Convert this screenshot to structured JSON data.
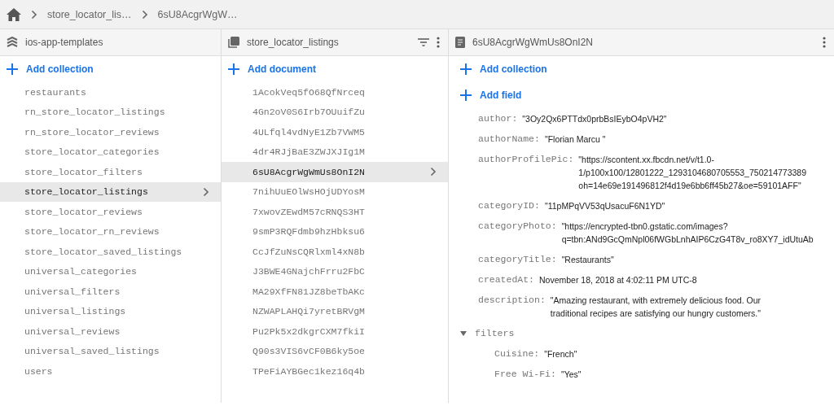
{
  "breadcrumb": [
    "store_locator_lis…",
    "6sU8AcgrWgW…"
  ],
  "collections": {
    "title": "ios-app-templates",
    "add_label": "Add collection",
    "items": [
      {
        "name": "restaurants",
        "selected": false
      },
      {
        "name": "rn_store_locator_listings",
        "selected": false
      },
      {
        "name": "rn_store_locator_reviews",
        "selected": false
      },
      {
        "name": "store_locator_categories",
        "selected": false
      },
      {
        "name": "store_locator_filters",
        "selected": false
      },
      {
        "name": "store_locator_listings",
        "selected": true
      },
      {
        "name": "store_locator_reviews",
        "selected": false
      },
      {
        "name": "store_locator_rn_reviews",
        "selected": false
      },
      {
        "name": "store_locator_saved_listings",
        "selected": false
      },
      {
        "name": "universal_categories",
        "selected": false
      },
      {
        "name": "universal_filters",
        "selected": false
      },
      {
        "name": "universal_listings",
        "selected": false
      },
      {
        "name": "universal_reviews",
        "selected": false
      },
      {
        "name": "universal_saved_listings",
        "selected": false
      },
      {
        "name": "users",
        "selected": false
      }
    ]
  },
  "documents": {
    "title": "store_locator_listings",
    "add_label": "Add document",
    "items": [
      {
        "name": "1AcokVeq5fO68QfNrceq",
        "selected": false
      },
      {
        "name": "4Gn2oV0S6Irb7OUuifZu",
        "selected": false
      },
      {
        "name": "4ULfql4vdNyE1Zb7VWM5",
        "selected": false
      },
      {
        "name": "4dr4RJjBaE3ZWJXJIg1M",
        "selected": false
      },
      {
        "name": "6sU8AcgrWgWmUs8OnI2N",
        "selected": true
      },
      {
        "name": "7nihUuEOlWsHOjUDYosM",
        "selected": false
      },
      {
        "name": "7xwovZEwdM57cRNQS3HT",
        "selected": false
      },
      {
        "name": "9smP3RQFdmb9hzHbksu6",
        "selected": false
      },
      {
        "name": "CcJfZuNsCQRlxml4xN8b",
        "selected": false
      },
      {
        "name": "J3BWE4GNajchFrru2FbC",
        "selected": false
      },
      {
        "name": "MA29XfFN81JZ8beTbAKc",
        "selected": false
      },
      {
        "name": "NZWAPLAHQi7yretBRVgM",
        "selected": false
      },
      {
        "name": "Pu2Pk5x2dkgrCXM7fkiI",
        "selected": false
      },
      {
        "name": "Q90s3VIS6vCF0B6ky5oe",
        "selected": false
      },
      {
        "name": "TPeFiAYBGec1kez16q4b",
        "selected": false
      }
    ]
  },
  "document": {
    "title": "6sU8AcgrWgWmUs8OnI2N",
    "add_collection": "Add collection",
    "add_field": "Add field",
    "fields": [
      {
        "kind": "field",
        "key": "author:",
        "value_lines": [
          "\"3Oy2Qx6PTTdx0prbBsIEybO4pVH2\""
        ]
      },
      {
        "kind": "field",
        "key": "authorName:",
        "value_lines": [
          "\"Florian Marcu \""
        ]
      },
      {
        "kind": "field",
        "key": "authorProfilePic:",
        "value_lines": [
          "\"https://scontent.xx.fbcdn.net/v/t1.0-",
          "1/p100x100/12801222_1293104680705553_750214773389",
          "oh=14e69e191496812f4d19e6bb6ff45b27&oe=59101AFF\""
        ]
      },
      {
        "kind": "field",
        "key": "categoryID:",
        "value_lines": [
          "\"11pMPqVV53qUsacuF6N1YD\""
        ]
      },
      {
        "kind": "field",
        "key": "categoryPhoto:",
        "value_lines": [
          "\"https://encrypted-tbn0.gstatic.com/images?",
          "q=tbn:ANd9GcQmNpl06fWGbLnhAIP6CzG4T8v_ro8XY7_idUtuAb"
        ]
      },
      {
        "kind": "field",
        "key": "categoryTitle:",
        "value_lines": [
          "\"Restaurants\""
        ]
      },
      {
        "kind": "field",
        "key": "createdAt:",
        "value_lines": [
          "November 18, 2018 at 4:02:11 PM UTC-8"
        ]
      },
      {
        "kind": "field",
        "key": "description:",
        "value_lines": [
          "\"Amazing restaurant, with extremely delicious food. Our",
          "traditional recipes are satisfying our hungry customers.\""
        ]
      },
      {
        "kind": "map",
        "key": "filters",
        "expanded": true,
        "children": [
          {
            "kind": "field",
            "key": "Cuisine:",
            "value_lines": [
              "\"French\""
            ]
          },
          {
            "kind": "field",
            "key": "Free Wi-Fi:",
            "value_lines": [
              "\"Yes\""
            ]
          }
        ]
      }
    ]
  }
}
